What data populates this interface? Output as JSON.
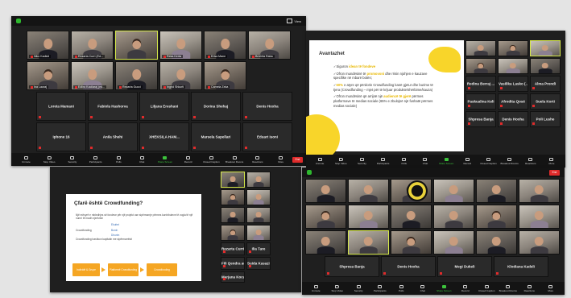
{
  "colors": {
    "accent": "#2eb82e",
    "end": "#e02b2b",
    "active_speaker": "#d6e84a",
    "slide_highlight": "#e8b800",
    "flow_box": "#f5a623"
  },
  "icons": [
    "security-shield-icon",
    "view-icon",
    "mic-icon",
    "camera-icon",
    "security-icon",
    "participants-icon",
    "chat-icon",
    "share-screen-icon",
    "record-icon",
    "reactions-icon",
    "more-icon"
  ],
  "win1": {
    "view_label": "View",
    "video_tiles": [
      {
        "name": "Niko Kadiuti"
      },
      {
        "name": "Rezarta Curri (Ed..."
      },
      {
        "name": ""
      },
      {
        "name": "Reka Kerta"
      },
      {
        "name": "Erisa Mane"
      },
      {
        "name": "Brixhita Raba"
      },
      {
        "name": "Ina Lauraj"
      },
      {
        "name": "Edlira Kacilaraj (ed..."
      },
      {
        "name": "Rezarta Gucci"
      },
      {
        "name": "Ingrid Shkurti"
      },
      {
        "name": "Camela Zeka"
      }
    ],
    "name_tiles": [
      "Loreta Mamani",
      "Fabiola Hashorva",
      "Liljana Ereshani",
      "Dorina Shehaj",
      "Denis Hoxha",
      "Iphone 16",
      "Anila Shehi",
      "XHEKSILA HAM...",
      "Marsela Sapellari",
      "Eduart Isoni"
    ],
    "toolbar": [
      {
        "label": "Unmute"
      },
      {
        "label": "Stop Video"
      },
      {
        "label": "Security"
      },
      {
        "label": "Participants"
      },
      {
        "label": "Polls"
      },
      {
        "label": "Chat"
      },
      {
        "label": "Share Screen"
      },
      {
        "label": "Record"
      },
      {
        "label": "Closed Caption"
      },
      {
        "label": "Breakout Rooms"
      },
      {
        "label": "Reactions"
      },
      {
        "label": "More"
      }
    ],
    "end_label": "End"
  },
  "win2": {
    "slide": {
      "title": "Avantazhet",
      "points": [
        {
          "pre": "✓Siguron ",
          "hl": "idean të fondeve",
          "post": ""
        },
        {
          "pre": "✓Ofron mundësinë të ",
          "hl": "promovoni",
          "post": " dhe rrisin njohjen e kauzave specifike në mbarë botën;"
        },
        {
          "pre": "✓",
          "hl": "60%",
          "post": " e atyre që përdorin Crowdfunding kanë gjetur dhe burime të tjera (Crowdfunding – mjet për të krijuar produkte/shërbime/kauza)"
        },
        {
          "pre": "✓Ofron mundësinë që arrijnë një ",
          "hl": "audiencë të gjerë",
          "post": " përmes platformave të medias sociale (65% e zbulojnë një fushatë përmes medias sociale)"
        }
      ]
    },
    "video_tiles": [
      {
        "name": ""
      },
      {
        "name": ""
      },
      {
        "name": ""
      },
      {
        "name": ""
      },
      {
        "name": ""
      },
      {
        "name": ""
      }
    ],
    "name_tiles": [
      "Redina Berraj ...",
      "Vasilika Lasko (...",
      "Alma Prendi",
      "Paskualina Keli",
      "Afrodita Qosé",
      "Suela Korti",
      "Shpresa Banja",
      "Denis Hoxha",
      "Poli Lushe"
    ]
  },
  "win3": {
    "slide": {
      "title": "Çfarë është Crowdfunding?",
      "bullets": [
        "Një mënyrë e mbledhjes së fondeve për një projekt ose sipërmarrje përmes kontributeve të vogla të një numri të madh njerëzish",
        "Crowdfunding",
        "Crowdfunding bashkon kapitalin me sipërmarrësit"
      ],
      "labels": [
        "Ekuitet",
        "Borxh",
        "Dhurim"
      ],
      "flow": [
        "Individë & Grupe",
        "Platformë Crowdfunding",
        "Crowdfunding"
      ]
    },
    "video_tiles": [
      {
        "name": ""
      },
      {
        "name": ""
      },
      {
        "name": ""
      },
      {
        "name": ""
      },
      {
        "name": ""
      },
      {
        "name": ""
      },
      {
        "name": ""
      },
      {
        "name": ""
      }
    ],
    "name_tiles": [
      "Rezarta Curri",
      "Ilia Tare",
      "Fili Qendra autiste",
      "Suida Kasazi - Kr...",
      "Marjana Kocaku"
    ]
  },
  "win4": {
    "video_tiles": [
      {
        "name": ""
      },
      {
        "name": ""
      },
      {
        "name": ""
      },
      {
        "name": ""
      },
      {
        "name": ""
      },
      {
        "name": ""
      },
      {
        "name": ""
      },
      {
        "name": ""
      },
      {
        "name": ""
      },
      {
        "name": ""
      },
      {
        "name": ""
      },
      {
        "name": ""
      },
      {
        "name": ""
      },
      {
        "name": ""
      },
      {
        "name": ""
      },
      {
        "name": ""
      },
      {
        "name": ""
      },
      {
        "name": ""
      }
    ],
    "name_tiles": [
      "Shpresa Banja",
      "Denis Hoxha",
      "Megi Dukeli",
      "Klodiana Kadeli"
    ],
    "end_label": "End"
  }
}
